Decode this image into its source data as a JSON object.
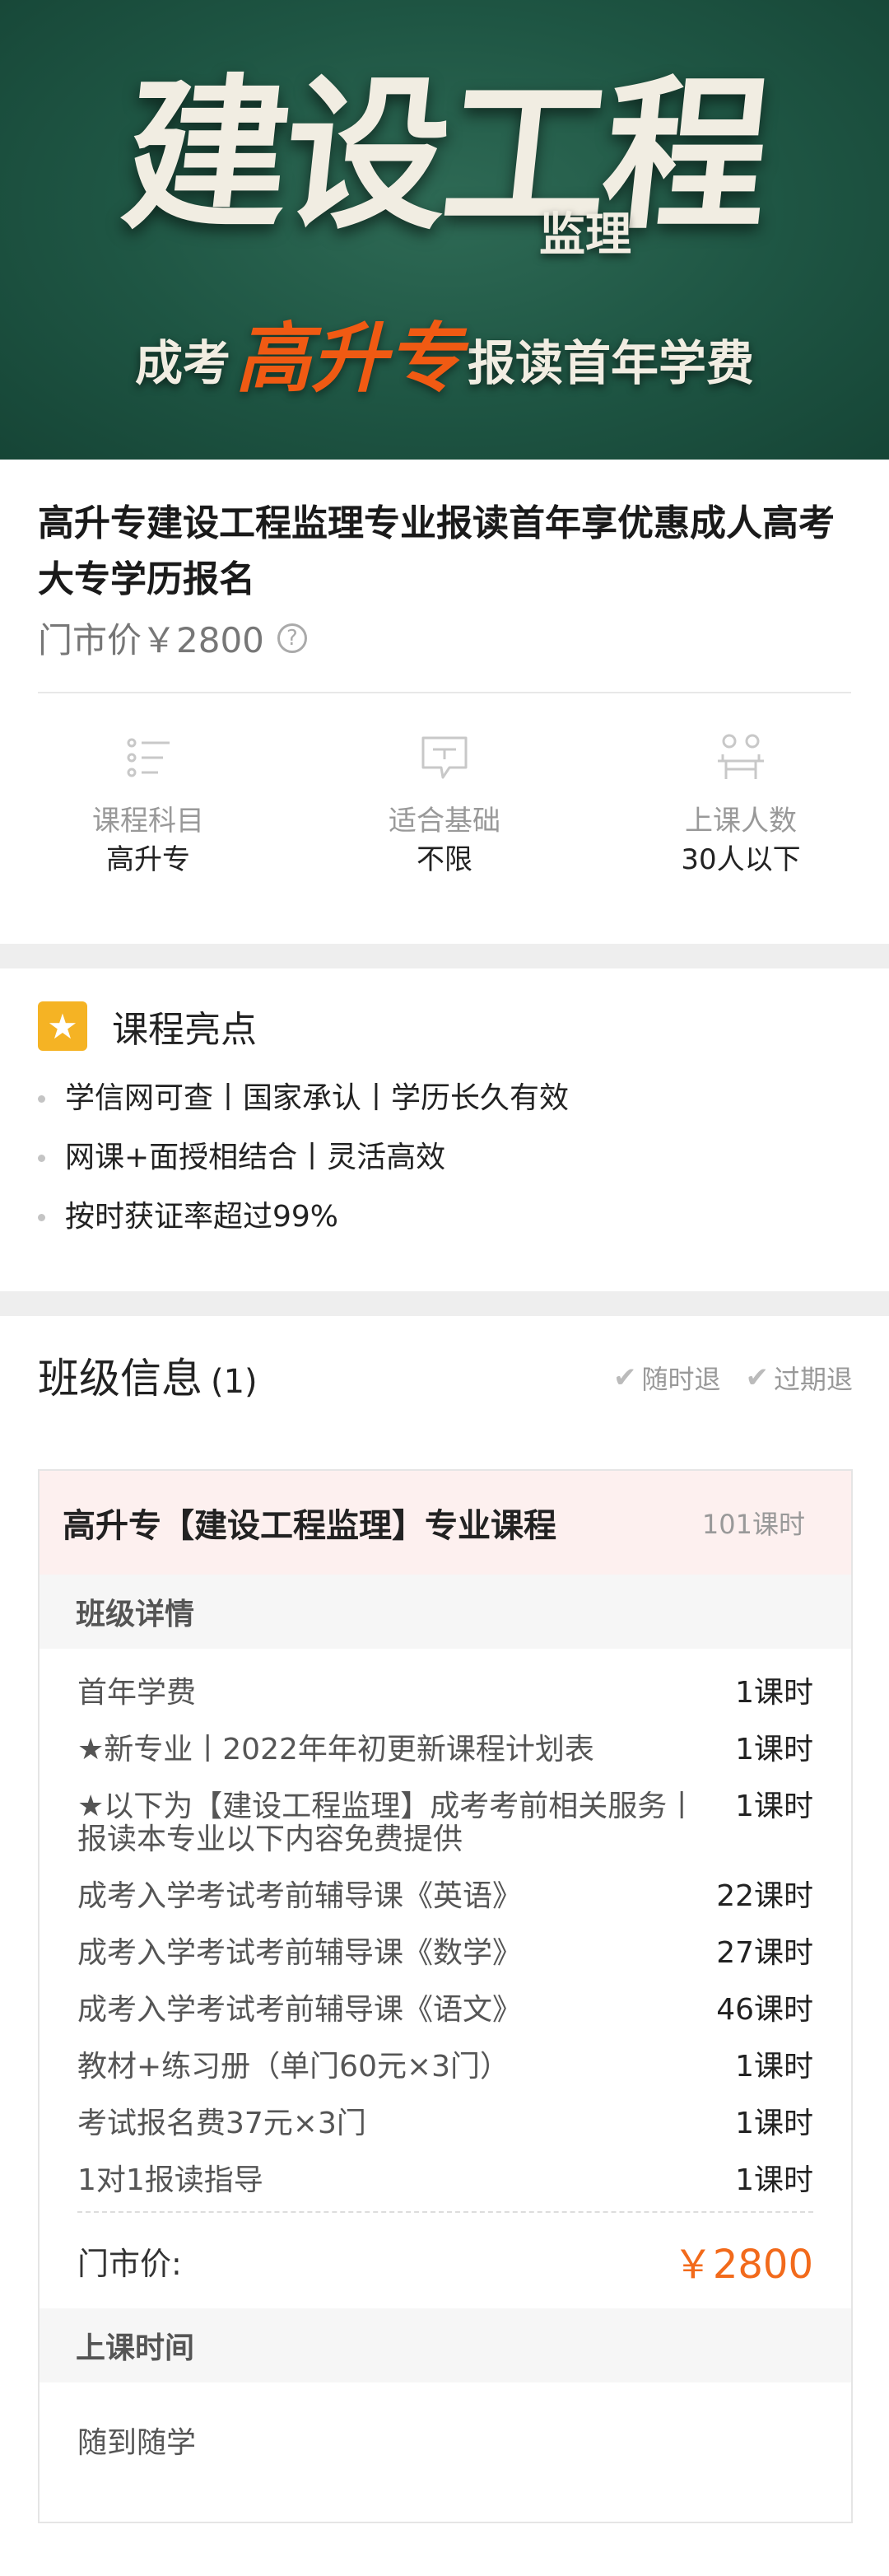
{
  "banner": {
    "main_text": "建设工程",
    "tag_text": "监理",
    "sub_left": "成考",
    "sub_mid": "高升专",
    "sub_right": "报读首年学费"
  },
  "course": {
    "title": "高升专建设工程监理专业报读首年享优惠成人高考大专学历报名",
    "market_price": "门市价￥2800",
    "help_icon": "?"
  },
  "stats": [
    {
      "icon": "list-icon",
      "label": "课程科目",
      "value": "高升专"
    },
    {
      "icon": "chat-board-icon",
      "label": "适合基础",
      "value": "不限"
    },
    {
      "icon": "people-icon",
      "label": "上课人数",
      "value": "30人以下"
    }
  ],
  "highlights": {
    "title": "课程亮点",
    "star": "★",
    "items": [
      "学信网可查丨国家承认丨学历长久有效",
      "网课+面授相结合丨灵活高效",
      "按时获证率超过99%"
    ]
  },
  "classes": {
    "title": "班级信息",
    "count": "(1)",
    "tags": [
      "随时退",
      "过期退"
    ],
    "check_glyph": "✔",
    "card": {
      "name": "高升专【建设工程监理】专业课程",
      "hours": "101课时",
      "detail_header": "班级详情",
      "rows": [
        {
          "name": "首年学费",
          "hours": "1课时"
        },
        {
          "name": "★新专业丨2022年年初更新课程计划表",
          "hours": "1课时"
        },
        {
          "name": "★以下为【建设工程监理】成考考前相关服务丨报读本专业以下内容免费提供",
          "hours": "1课时"
        },
        {
          "name": "成考入学考试考前辅导课《英语》",
          "hours": "22课时"
        },
        {
          "name": "成考入学考试考前辅导课《数学》",
          "hours": "27课时"
        },
        {
          "name": "成考入学考试考前辅导课《语文》",
          "hours": "46课时"
        },
        {
          "name": "教材+练习册（单门60元×3门）",
          "hours": "1课时"
        },
        {
          "name": "考试报名费37元×3门",
          "hours": "1课时"
        },
        {
          "name": "1对1报读指导",
          "hours": "1课时"
        }
      ],
      "price_label": "门市价:",
      "price_value": "￥2800",
      "time_header": "上课时间",
      "time_value": "随到随学"
    }
  },
  "colors": {
    "banner_bg": "#1e5543",
    "accent_orange": "#f26a1b",
    "star_yellow": "#f5b324",
    "card_pink": "#fdf0ef"
  }
}
